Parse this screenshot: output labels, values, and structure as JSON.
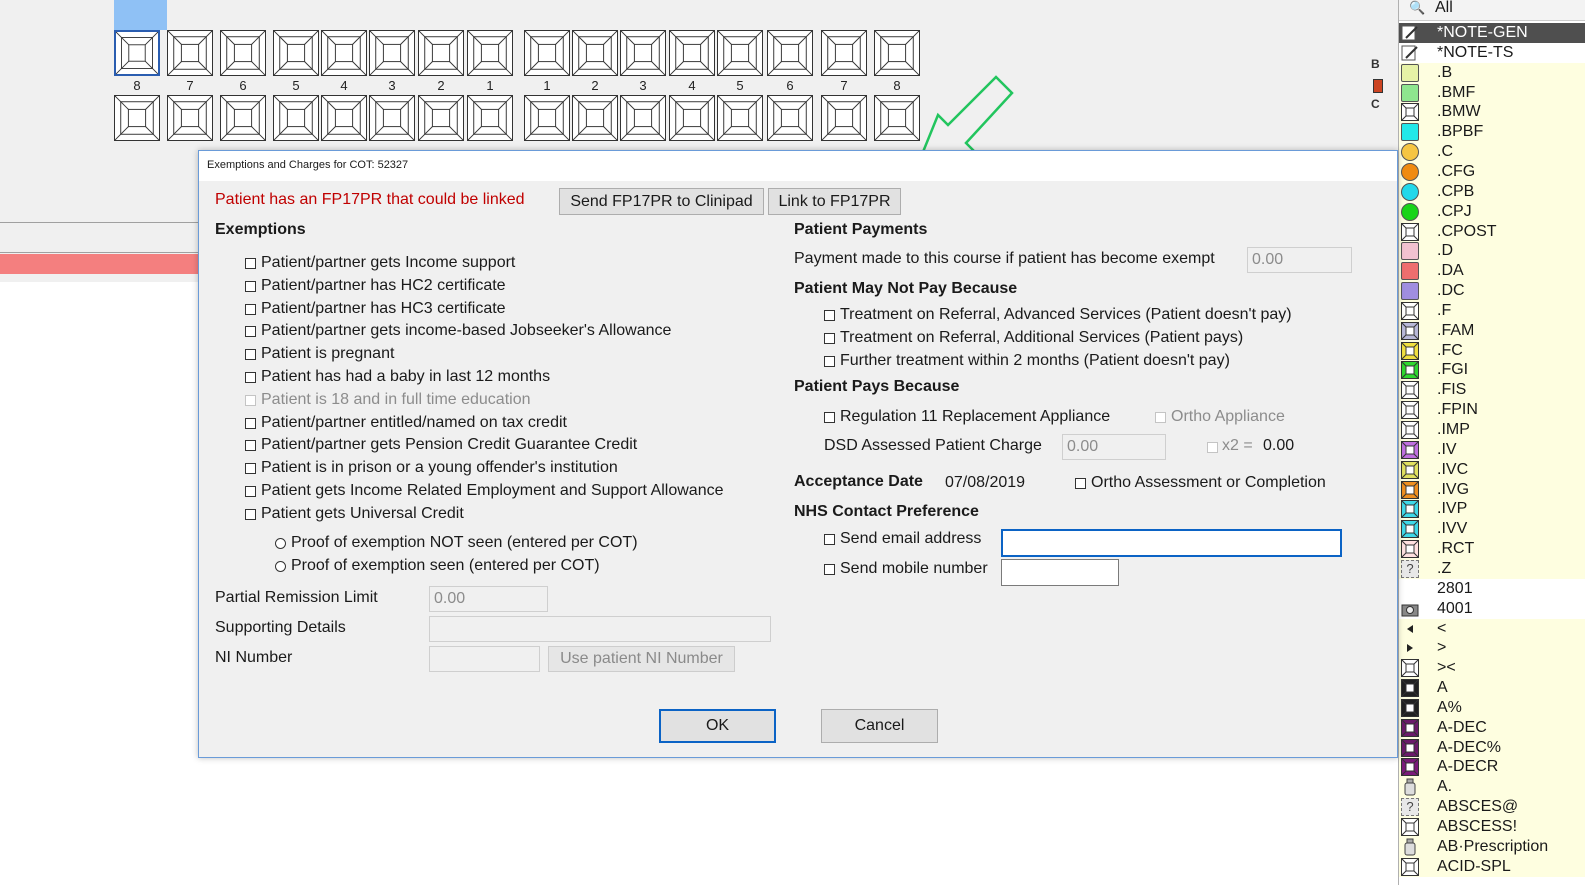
{
  "chart": {
    "upper_row_numbers": [
      "8",
      "7",
      "6",
      "5",
      "4",
      "3",
      "2",
      "1",
      "1",
      "2",
      "3",
      "4",
      "5",
      "6",
      "7",
      "8"
    ],
    "side_labels": {
      "b": "B",
      "c": "C"
    }
  },
  "sidebar": {
    "search_value": "All",
    "items": [
      {
        "label": "*NOTE-GEN",
        "icon": "edit-note-icon",
        "color": "#e0e0e0"
      },
      {
        "label": "*NOTE-TS",
        "icon": "edit-note-icon",
        "color": "#e0e0e0"
      },
      {
        "label": ".B",
        "icon": "square-swatch-icon",
        "color": "#e6f2a6"
      },
      {
        "label": ".BMF",
        "icon": "square-swatch-icon",
        "color": "#8ee58e"
      },
      {
        "label": ".BMW",
        "icon": "tooth-box-icon",
        "color": "#ffffff"
      },
      {
        "label": ".BPBF",
        "icon": "square-swatch-icon",
        "color": "#22e8e8"
      },
      {
        "label": ".C",
        "icon": "circle-swatch-icon",
        "color": "#f5c542"
      },
      {
        "label": ".CFG",
        "icon": "circle-swatch-icon",
        "color": "#ef8a10"
      },
      {
        "label": ".CPB",
        "icon": "circle-swatch-icon",
        "color": "#22d8ea"
      },
      {
        "label": ".CPJ",
        "icon": "circle-swatch-icon",
        "color": "#18d418"
      },
      {
        "label": ".CPOST",
        "icon": "post-icon",
        "color": "#ffffff"
      },
      {
        "label": ".D",
        "icon": "square-swatch-icon",
        "color": "#f2c2d0"
      },
      {
        "label": ".DA",
        "icon": "square-swatch-icon",
        "color": "#ee6e6e"
      },
      {
        "label": ".DC",
        "icon": "square-swatch-icon",
        "color": "#a08ee0"
      },
      {
        "label": ".F",
        "icon": "tooth-box-icon",
        "color": "#ffffff"
      },
      {
        "label": ".FAM",
        "icon": "tooth-box-icon",
        "color": "#b8b8d8"
      },
      {
        "label": ".FC",
        "icon": "tooth-box-icon",
        "color": "#f0e040"
      },
      {
        "label": ".FGI",
        "icon": "tooth-box-icon",
        "color": "#30d830"
      },
      {
        "label": ".FIS",
        "icon": "tooth-box-icon",
        "color": "#ffffff"
      },
      {
        "label": ".FPIN",
        "icon": "tooth-box-icon",
        "color": "#ffffff"
      },
      {
        "label": ".IMP",
        "icon": "implant-icon",
        "color": "#ffffff"
      },
      {
        "label": ".IV",
        "icon": "tooth-box-icon",
        "color": "#c070e0"
      },
      {
        "label": ".IVC",
        "icon": "tooth-box-icon",
        "color": "#e0e060"
      },
      {
        "label": ".IVG",
        "icon": "tooth-box-icon",
        "color": "#f09020"
      },
      {
        "label": ".IVP",
        "icon": "tooth-box-icon",
        "color": "#40d8e8"
      },
      {
        "label": ".IVV",
        "icon": "tooth-box-icon",
        "color": "#40d8e8"
      },
      {
        "label": ".RCT",
        "icon": "tooth-box-icon",
        "color": "#ffe0e0"
      },
      {
        "label": ".Z",
        "icon": "question-icon",
        "color": "#e8e8e8"
      },
      {
        "label": "2801",
        "icon": "",
        "color": "#ffffff"
      },
      {
        "label": "4001",
        "icon": "camera-icon",
        "color": "#cccccc"
      },
      {
        "label": "<",
        "icon": "left-triangle-icon",
        "color": "#ffffff"
      },
      {
        "label": ">",
        "icon": "right-triangle-icon",
        "color": "#ffffff"
      },
      {
        "label": "><",
        "icon": "tooth-box-icon",
        "color": "#ffffff"
      },
      {
        "label": "A",
        "icon": "tooth-box-icon",
        "color": "#222222"
      },
      {
        "label": "A%",
        "icon": "tooth-box-icon",
        "color": "#222222"
      },
      {
        "label": "A-DEC",
        "icon": "tooth-box-icon",
        "color": "#6a1a6a"
      },
      {
        "label": "A-DEC%",
        "icon": "tooth-box-icon",
        "color": "#6a1a6a"
      },
      {
        "label": "A-DECR",
        "icon": "tooth-box-icon",
        "color": "#7a1a7a"
      },
      {
        "label": "A.",
        "icon": "bottle-icon",
        "color": "#dddddd"
      },
      {
        "label": "ABSCES@",
        "icon": "question-icon",
        "color": "#e8e8e8"
      },
      {
        "label": "ABSCESS!",
        "icon": "tooth-box-icon",
        "color": "#ffffff"
      },
      {
        "label": "AB·Prescription",
        "icon": "pill-icon",
        "color": "#dddddd"
      },
      {
        "label": "ACID-SPL",
        "icon": "tooth-box-icon",
        "color": "#ffffff"
      }
    ]
  },
  "dialog": {
    "title": "Exemptions and Charges for COT: 52327",
    "fp17_notice": "Patient has an FP17PR that could be linked",
    "send_fp17_button": "Send FP17PR to Clinipad",
    "link_fp17_button": "Link to FP17PR",
    "exemptions": {
      "heading": "Exemptions",
      "items": [
        {
          "label": "Patient/partner gets Income support",
          "enabled": true
        },
        {
          "label": "Patient/partner has HC2 certificate",
          "enabled": true
        },
        {
          "label": "Patient/partner has HC3 certificate",
          "enabled": true
        },
        {
          "label": "Patient/partner gets income-based Jobseeker's Allowance",
          "enabled": true
        },
        {
          "label": "Patient is pregnant",
          "enabled": true
        },
        {
          "label": "Patient has had a baby in last 12 months",
          "enabled": true
        },
        {
          "label": "Patient is 18 and in full time education",
          "enabled": false
        },
        {
          "label": "Patient/partner entitled/named on tax credit",
          "enabled": true
        },
        {
          "label": "Patient/partner gets Pension Credit Guarantee Credit",
          "enabled": true
        },
        {
          "label": "Patient is in prison or a young offender's institution",
          "enabled": true
        },
        {
          "label": "Patient gets Income Related Employment and Support Allowance",
          "enabled": true
        },
        {
          "label": "Patient gets Universal Credit",
          "enabled": true
        }
      ],
      "proof_not_seen": "Proof of exemption NOT seen (entered per COT)",
      "proof_seen": "Proof of exemption seen (entered per COT)"
    },
    "partial_remission": {
      "label": "Partial Remission Limit",
      "value": "0.00"
    },
    "supporting_details": {
      "label": "Supporting Details",
      "value": ""
    },
    "ni_number": {
      "label": "NI Number",
      "value": "",
      "button": "Use patient NI Number"
    },
    "patient_payments": {
      "heading": "Patient Payments",
      "payment_label": "Payment made to this course if patient has become exempt",
      "payment_value": "0.00"
    },
    "may_not_pay": {
      "heading": "Patient May Not Pay Because",
      "items": [
        "Treatment on Referral, Advanced Services (Patient doesn't pay)",
        "Treatment on Referral, Additional Services (Patient pays)",
        "Further treatment within 2 months (Patient doesn't pay)"
      ]
    },
    "pays_because": {
      "heading": "Patient Pays Because",
      "regulation_label": "Regulation 11 Replacement Appliance",
      "ortho_appliance_label": "Ortho Appliance",
      "dsd_label": "DSD Assessed Patient Charge",
      "dsd_value": "0.00",
      "x2_label": "x2 =",
      "x2_value": "0.00"
    },
    "acceptance": {
      "label": "Acceptance Date",
      "date": "07/08/2019",
      "ortho_label": "Ortho Assessment or Completion"
    },
    "nhs_contact": {
      "heading": "NHS Contact Preference",
      "email_label": "Send email address",
      "email_value": "",
      "mobile_label": "Send mobile number",
      "mobile_value": ""
    },
    "ok_button": "OK",
    "cancel_button": "Cancel"
  },
  "colors": {
    "accent_blue": "#0b63c5",
    "notice_red": "#c00000",
    "arrow_green": "#22c55e",
    "red_bar": "#f47f7f"
  }
}
